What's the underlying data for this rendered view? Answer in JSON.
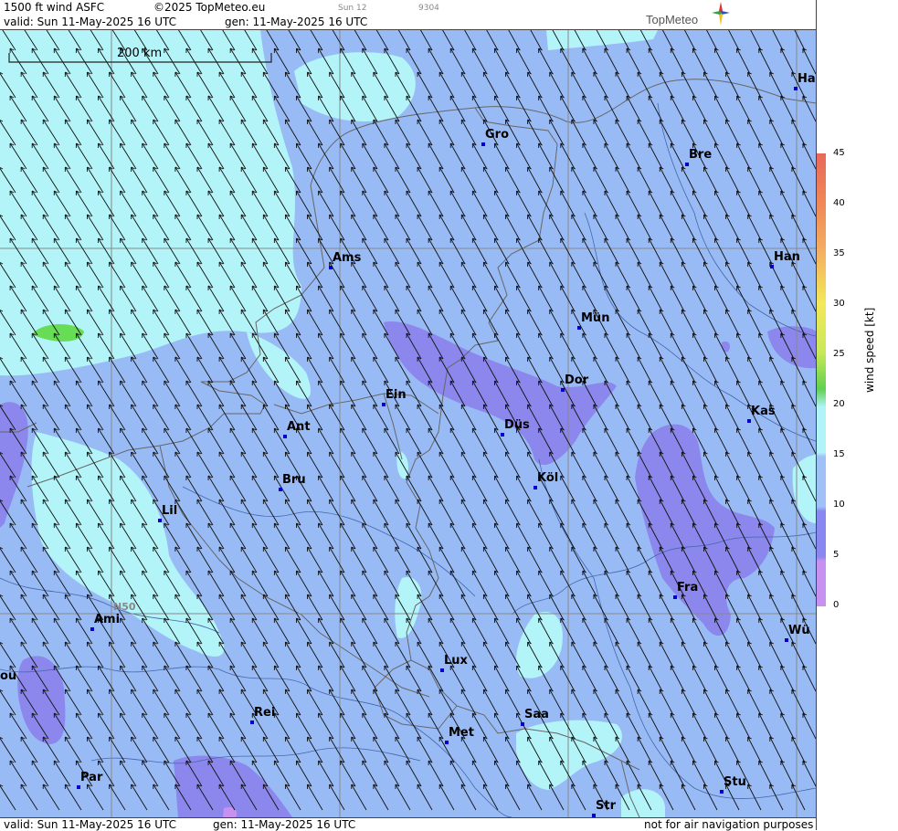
{
  "header": {
    "product": "1500 ft wind ASFC",
    "copyright": "©2025 TopMeteo.eu",
    "extra1": "Sun 12",
    "extra2": "9304",
    "valid": "valid:  Sun  11-May-2025  16 UTC",
    "gen": "gen: 11-May-2025 16 UTC",
    "logo": "TopMeteo"
  },
  "footer": {
    "valid": "valid:  Sun  11-May-2025  16 UTC",
    "gen": "gen: 11-May-2025 16 UTC",
    "disclaimer": "not for air navigation purposes"
  },
  "scale": {
    "label": "200 km"
  },
  "grid_label": "N50",
  "legend": {
    "title": "wind  speed  [kt]",
    "ticks": [
      "45",
      "40",
      "35",
      "30",
      "25",
      "20",
      "15",
      "10",
      "5",
      "0"
    ],
    "colors": [
      "#e06060",
      "#f08050",
      "#f0a060",
      "#f0d050",
      "#e8f060",
      "#c0e850",
      "#60d050",
      "#b0f4f8",
      "#a0c0f8",
      "#8890f0",
      "#c890f0"
    ]
  },
  "colors": {
    "base": "#99bbf5",
    "cyan": "#b2f4f8",
    "purple": "#8c87ec",
    "green": "#66dd55",
    "borders": "#555555"
  },
  "cities": [
    {
      "name": "Ha"
    },
    {
      "name": "Gro"
    },
    {
      "name": "Bre"
    },
    {
      "name": "Ams"
    },
    {
      "name": "Han"
    },
    {
      "name": "Mün"
    },
    {
      "name": "Ein"
    },
    {
      "name": "Dor"
    },
    {
      "name": "Kas"
    },
    {
      "name": "Ant"
    },
    {
      "name": "Düs"
    },
    {
      "name": "Bru"
    },
    {
      "name": "Köl"
    },
    {
      "name": "Lil"
    },
    {
      "name": "Fra"
    },
    {
      "name": "Ami"
    },
    {
      "name": "Wü"
    },
    {
      "name": "Lux"
    },
    {
      "name": "ou"
    },
    {
      "name": "Rei"
    },
    {
      "name": "Saa"
    },
    {
      "name": "Met"
    },
    {
      "name": "Par"
    },
    {
      "name": "Stu"
    },
    {
      "name": "Str"
    }
  ]
}
